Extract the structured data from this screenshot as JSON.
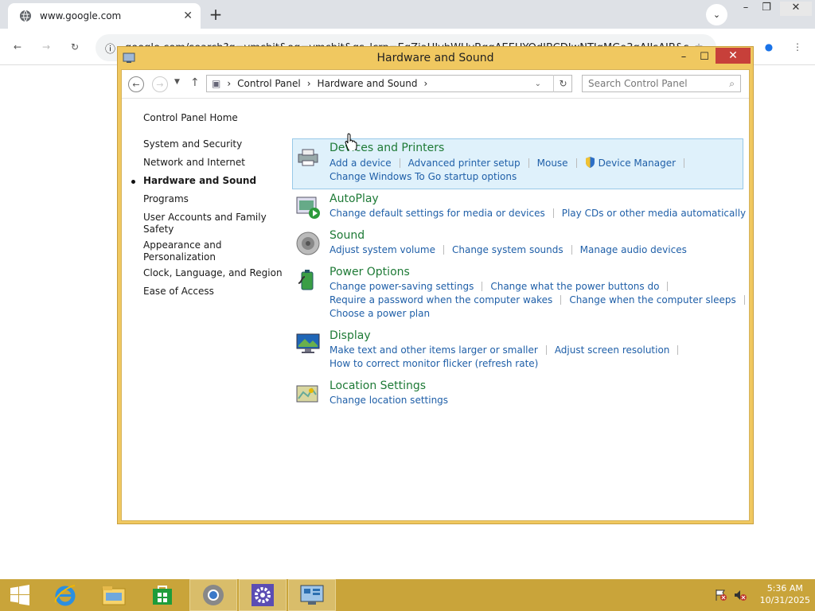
{
  "browser": {
    "tab_title": "www.google.com",
    "url": "google.com/search?q=vmcbit&oq=vmcbit&gs_lcrp=EgZjaHJvbWUyBggAEEUYOdIBCDIwNTIqMGo3qAIIsAIB&s"
  },
  "window": {
    "title": "Hardware and Sound",
    "breadcrumb": [
      "Control Panel",
      "Hardware and Sound"
    ],
    "search_placeholder": "Search Control Panel"
  },
  "nav": {
    "home": "Control Panel Home",
    "items": [
      {
        "label": "System and Security"
      },
      {
        "label": "Network and Internet"
      },
      {
        "label": "Hardware and Sound"
      },
      {
        "label": "Programs"
      },
      {
        "label": "User Accounts and Family"
      },
      {
        "label": "Safety"
      },
      {
        "label": "Appearance and"
      },
      {
        "label": "Personalization"
      },
      {
        "label": "Clock, Language, and Region"
      },
      {
        "label": "Ease of Access"
      }
    ]
  },
  "categories": [
    {
      "title": "Devices and Printers",
      "rows": [
        [
          "Add a device",
          "Advanced printer setup",
          "Mouse",
          "Device Manager"
        ],
        [
          "Change Windows To Go startup options"
        ]
      ]
    },
    {
      "title": "AutoPlay",
      "rows": [
        [
          "Change default settings for media or devices",
          "Play CDs or other media automatically"
        ]
      ]
    },
    {
      "title": "Sound",
      "rows": [
        [
          "Adjust system volume",
          "Change system sounds",
          "Manage audio devices"
        ]
      ]
    },
    {
      "title": "Power Options",
      "rows": [
        [
          "Change power-saving settings",
          "Change what the power buttons do"
        ],
        [
          "Require a password when the computer wakes",
          "Change when the computer sleeps"
        ],
        [
          "Choose a power plan"
        ]
      ]
    },
    {
      "title": "Display",
      "rows": [
        [
          "Make text and other items larger or smaller",
          "Adjust screen resolution"
        ],
        [
          "How to correct monitor flicker (refresh rate)"
        ]
      ]
    },
    {
      "title": "Location Settings",
      "rows": [
        [
          "Change location settings"
        ]
      ]
    }
  ],
  "taskbar": {
    "time": "5:36 AM",
    "date": "10/31/2025"
  },
  "colors": {
    "window_frame": "#f0c860",
    "link": "#1f5fa8",
    "category_title": "#1e7a36",
    "taskbar": "#c9a43a"
  }
}
